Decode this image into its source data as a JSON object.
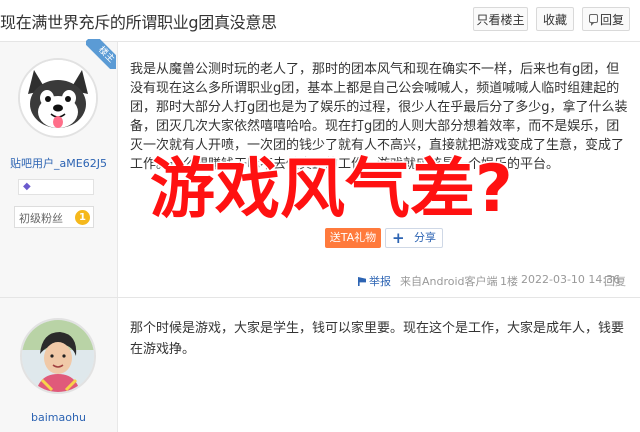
{
  "thread": {
    "title": "现在满世界充斥的所谓职业g团真没意思",
    "buttons": {
      "only_op": "只看楼主",
      "favorite": "收藏",
      "reply": "回复"
    }
  },
  "post1": {
    "op_badge": "楼主",
    "username": "贴吧用户_aME62J5",
    "avatar_icon": "husky-dog-avatar",
    "level_name": "初级粉丝",
    "level_num": "1",
    "body": "我是从魔兽公测时玩的老人了，那时的团本风气和现在确实不一样，后来也有g团，但没有现在这么多所谓职业g团，基本上都是自己公会喊喊人，频道喊喊人临时组建起的团，那时大部分人打g团也是为了娱乐的过程，很少人在乎最后分了多少g，拿了什么装备，团灭几次大家依然嘻嘻哈哈。现在打g团的人则大部分想着效率，而不是娱乐，团灭一次就有人开喷，一次团的钱少了就有人不高兴，直接就把游戏变成了生意，变成了工作。这么想赚钱干嘛不去做真正的工作，游戏就应该是一个娱乐的平台。",
    "overlay_text": "游戏风气差?",
    "gift_label": "送TA礼物",
    "share_label": "分享",
    "report_label": "举报",
    "source": "来自Android客户端",
    "floor": "1楼",
    "time": "2022-03-10 14:36",
    "reply_label": "回复"
  },
  "post2": {
    "username": "baimaohu",
    "avatar_icon": "person-photo-avatar",
    "body": "那个时候是游戏，大家是学生，钱可以家里要。现在这个是工作，大家是成年人，钱要在游戏挣。"
  },
  "colors": {
    "link": "#2d64b3",
    "overlay": "#ff1111",
    "gift": "#ff7a3c",
    "ribbon": "#5b9bd5"
  }
}
